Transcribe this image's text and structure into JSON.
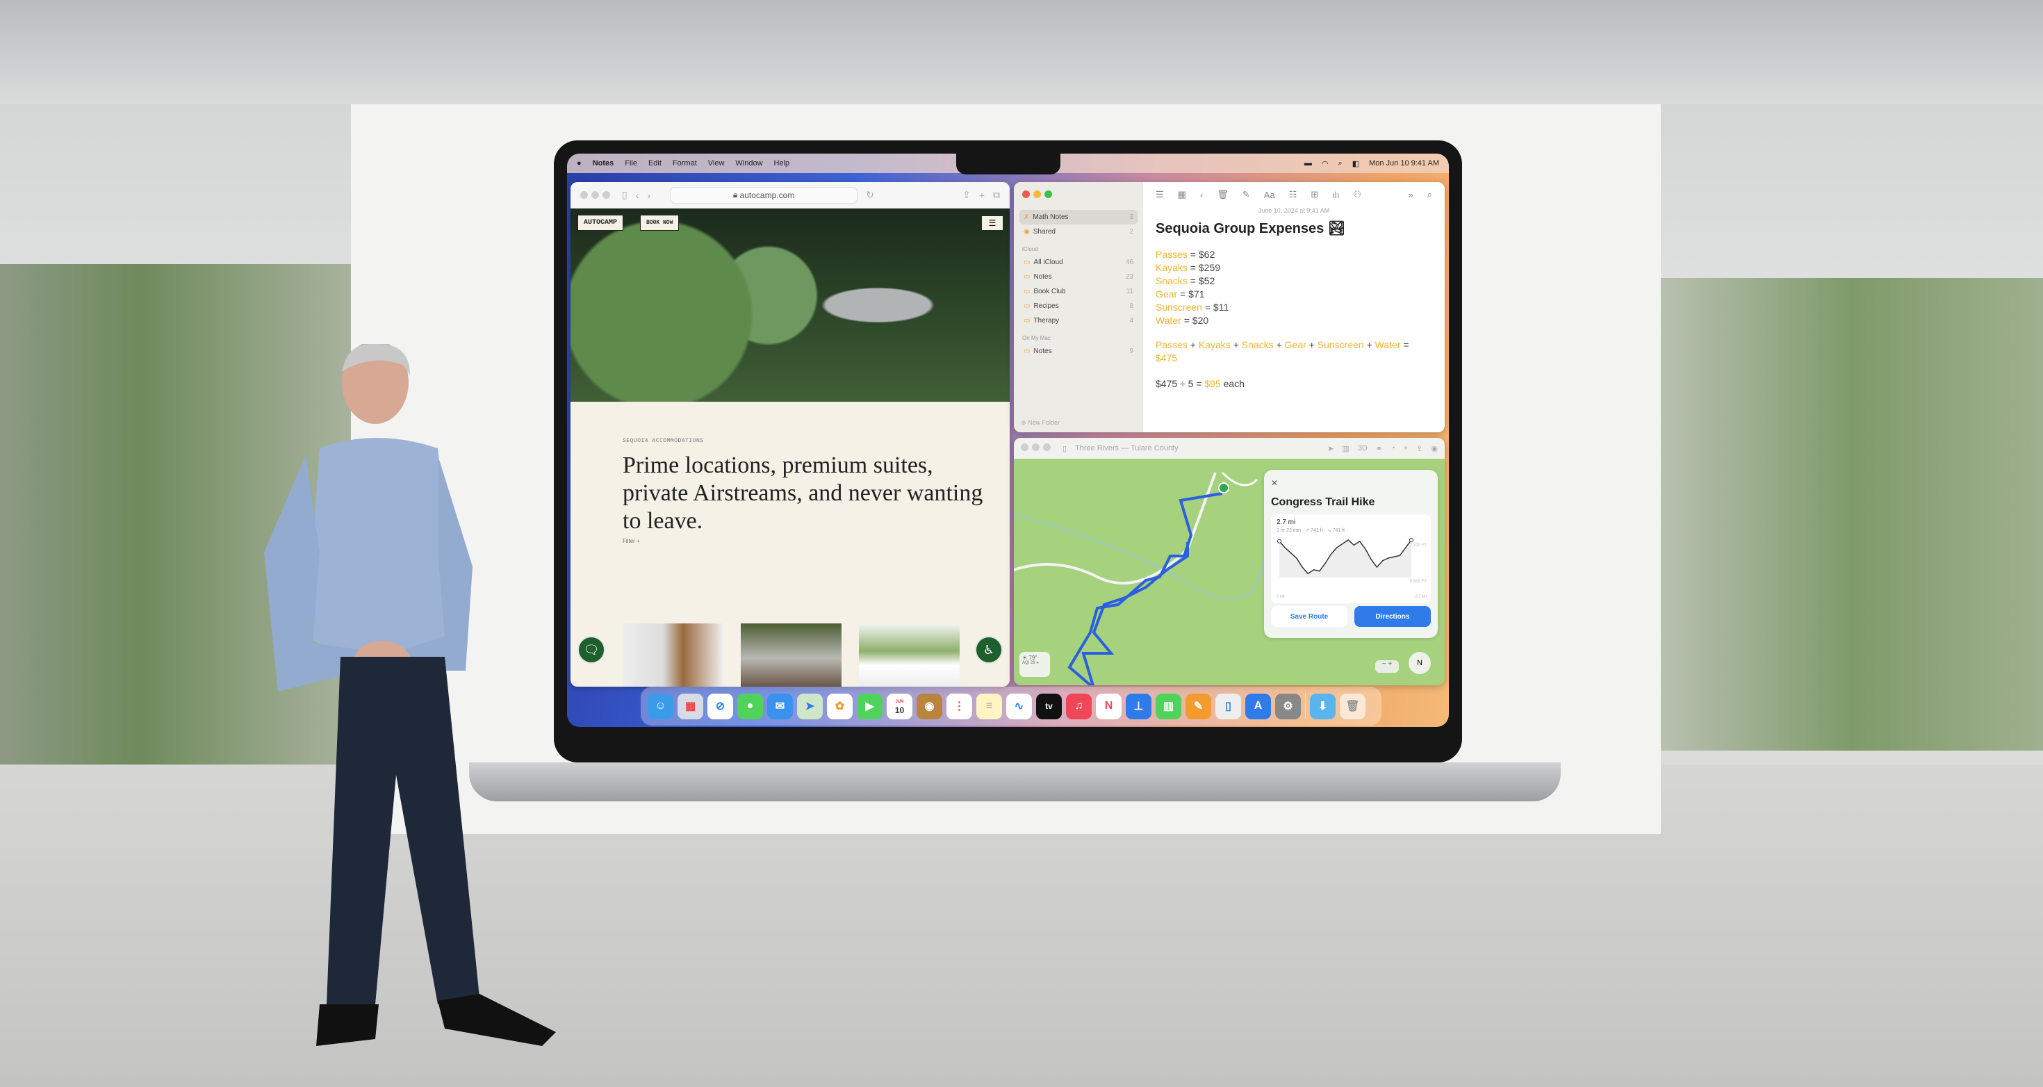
{
  "menubar": {
    "app": "Notes",
    "items": [
      "File",
      "Edit",
      "Format",
      "View",
      "Window",
      "Help"
    ],
    "clock": "Mon Jun 10 9:41 AM"
  },
  "safari": {
    "url": "autocamp.com",
    "logo": "AUTOCAMP",
    "book_now": "BOOK NOW",
    "eyebrow": "SEQUOIA ACCOMMODATIONS",
    "headline": "Prime locations, premium suites, private Airstreams, and never wanting to leave.",
    "filter": "Filter +"
  },
  "notes": {
    "sidebar": {
      "top": [
        {
          "label": "Math Notes",
          "count": "3"
        },
        {
          "label": "Shared",
          "count": "2"
        }
      ],
      "icloud_header": "iCloud",
      "icloud": [
        {
          "label": "All iCloud",
          "count": "46"
        },
        {
          "label": "Notes",
          "count": "23"
        },
        {
          "label": "Book Club",
          "count": "11"
        },
        {
          "label": "Recipes",
          "count": "8"
        },
        {
          "label": "Therapy",
          "count": "4"
        }
      ],
      "mac_header": "On My Mac",
      "mac": [
        {
          "label": "Notes",
          "count": "9"
        }
      ],
      "new_folder": "New Folder"
    },
    "date": "June 10, 2024 at 9:41 AM",
    "title": "Sequoia Group Expenses",
    "expenses": [
      {
        "name": "Passes",
        "value": "$62"
      },
      {
        "name": "Kayaks",
        "value": "$259"
      },
      {
        "name": "Snacks",
        "value": "$52"
      },
      {
        "name": "Gear",
        "value": "$71"
      },
      {
        "name": "Sunscreen",
        "value": "$11"
      },
      {
        "name": "Water",
        "value": "$20"
      }
    ],
    "sum_result": "$475",
    "division": "$475 ÷ 5 = ",
    "division_result": "$95",
    "division_suffix": " each"
  },
  "maps": {
    "title": "Three Rivers — Tulare County",
    "toolbar_3d": "3D",
    "card": {
      "title": "Congress Trail Hike",
      "distance": "2.7 mi",
      "details": "1 hr 23 min · ↗ 741 ft · ↘ 741 ft",
      "elev_max": "7,100 FT",
      "elev_min": "6,800 FT",
      "x_start": "0 MI",
      "x_end": "2.7 MI",
      "profile_ft": [
        7080,
        7030,
        6990,
        6950,
        6880,
        6830,
        6860,
        6850,
        6910,
        6980,
        7030,
        7060,
        7090,
        7050,
        7080,
        7020,
        6940,
        6880,
        6930,
        6950,
        6960,
        6970,
        7030,
        7090
      ],
      "save": "Save Route",
      "directions": "Directions"
    },
    "weather": {
      "temp": "79°",
      "aqi": "AQI 29"
    },
    "compass": "N"
  },
  "dock": {
    "calendar_month": "JUN",
    "calendar_day": "10",
    "tv": "tv"
  },
  "colors": {
    "accent_blue": "#2f7bea",
    "notes_yellow": "#f0b22e",
    "map_green": "#a6d17d",
    "route_blue": "#2a5fe0"
  }
}
